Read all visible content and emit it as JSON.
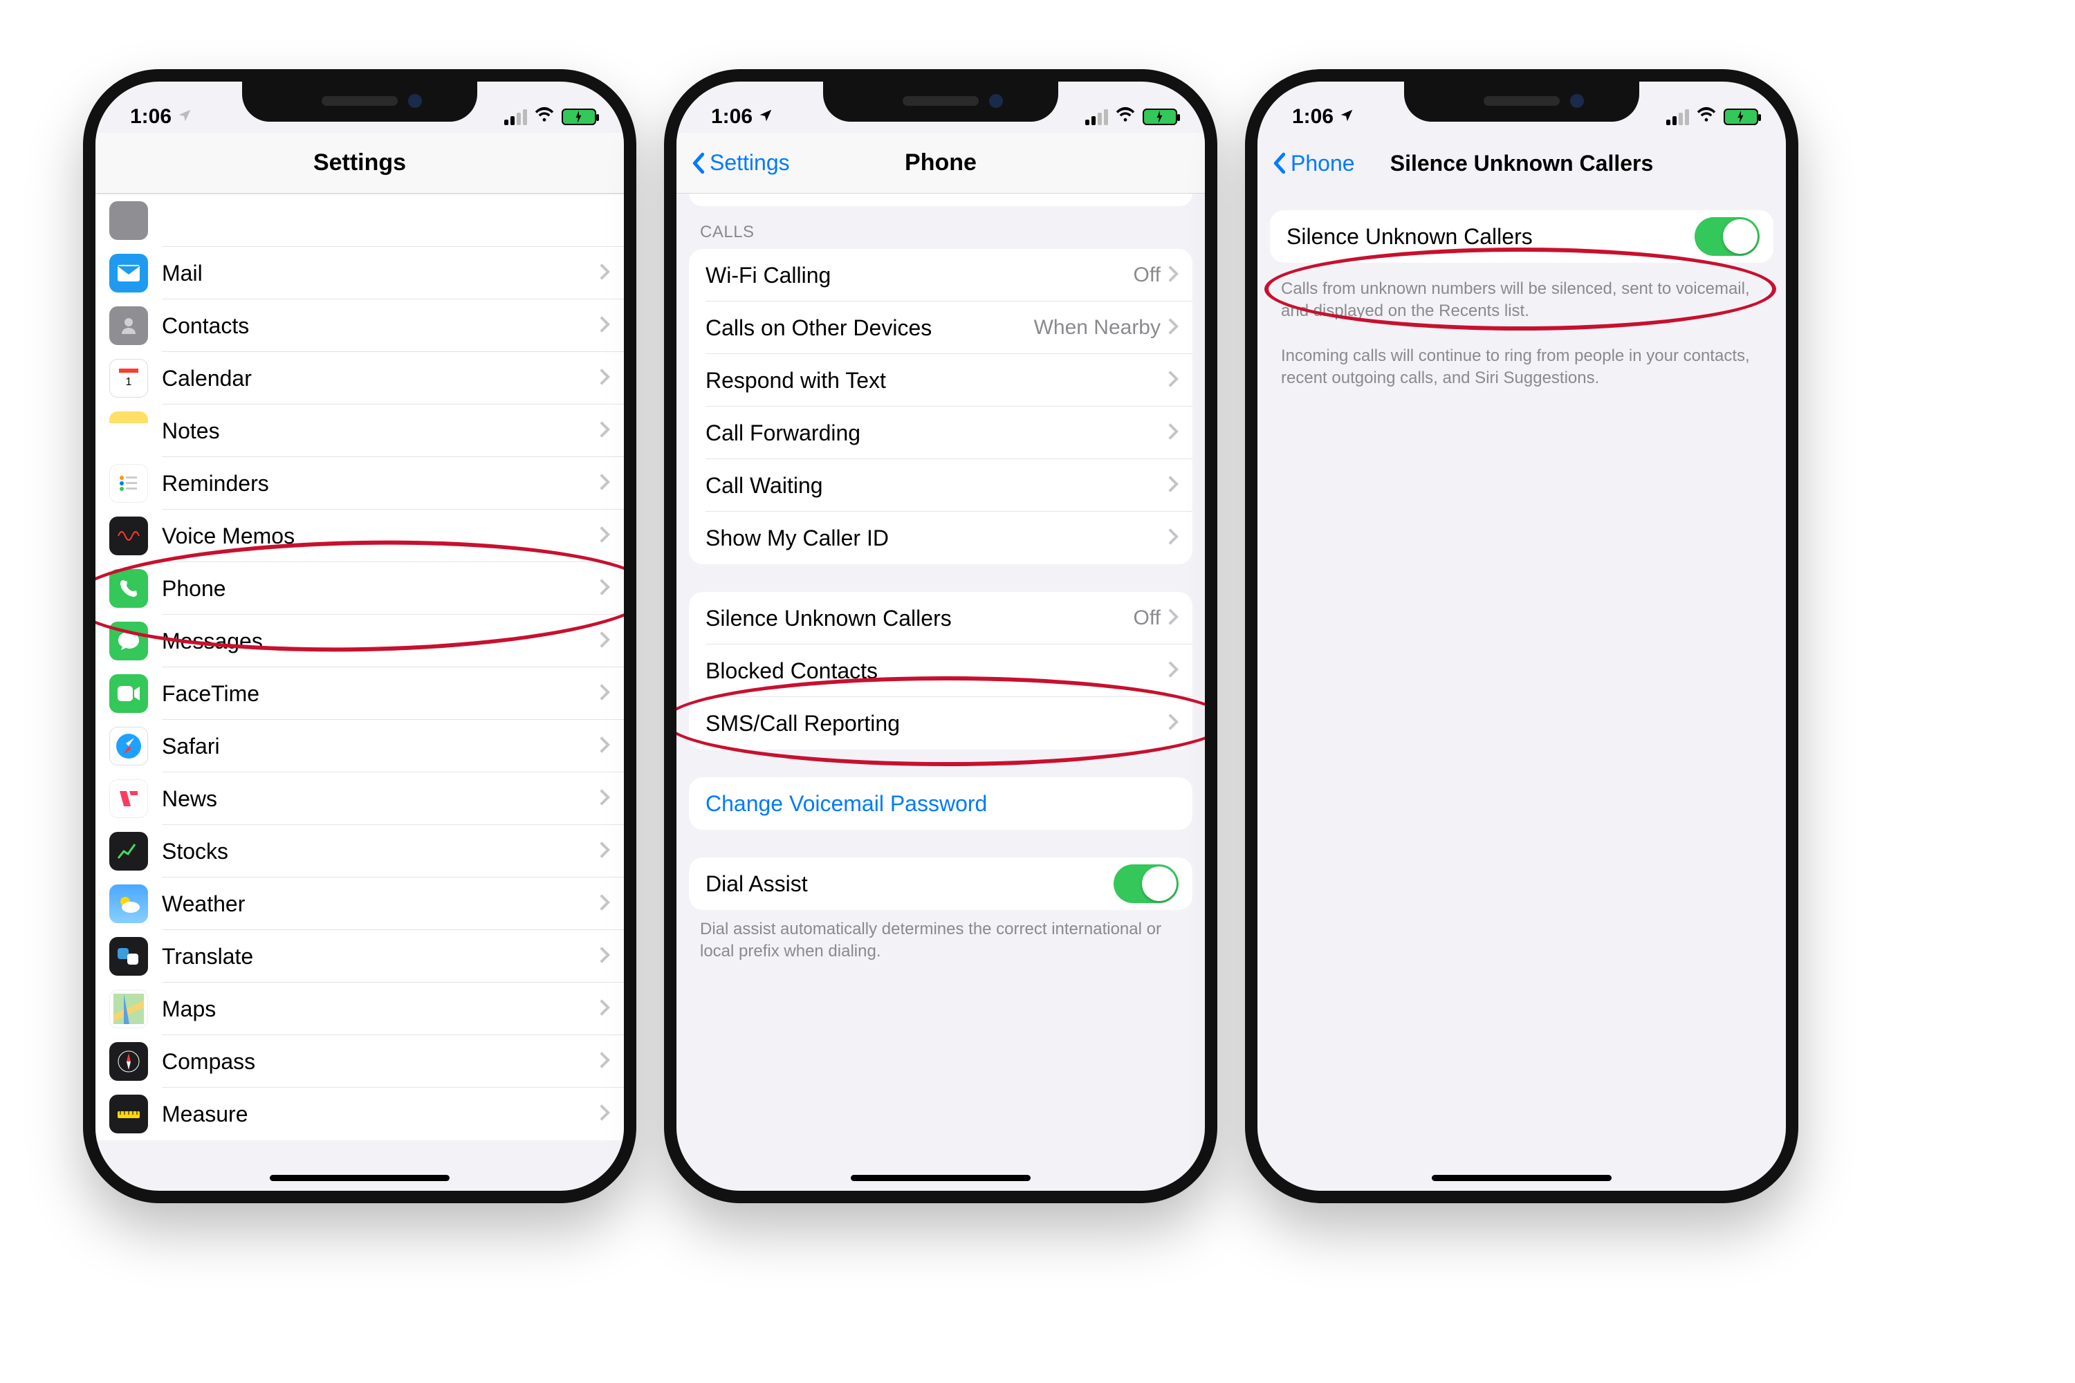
{
  "statusbar": {
    "time": "1:06"
  },
  "phone1": {
    "title": "Settings",
    "items": [
      {
        "label": "Mail"
      },
      {
        "label": "Contacts"
      },
      {
        "label": "Calendar"
      },
      {
        "label": "Notes"
      },
      {
        "label": "Reminders"
      },
      {
        "label": "Voice Memos"
      },
      {
        "label": "Phone"
      },
      {
        "label": "Messages"
      },
      {
        "label": "FaceTime"
      },
      {
        "label": "Safari"
      },
      {
        "label": "News"
      },
      {
        "label": "Stocks"
      },
      {
        "label": "Weather"
      },
      {
        "label": "Translate"
      },
      {
        "label": "Maps"
      },
      {
        "label": "Compass"
      },
      {
        "label": "Measure"
      }
    ]
  },
  "phone2": {
    "back": "Settings",
    "title": "Phone",
    "section_calls": "CALLS",
    "calls": [
      {
        "label": "Wi-Fi Calling",
        "value": "Off"
      },
      {
        "label": "Calls on Other Devices",
        "value": "When Nearby"
      },
      {
        "label": "Respond with Text",
        "value": ""
      },
      {
        "label": "Call Forwarding",
        "value": ""
      },
      {
        "label": "Call Waiting",
        "value": ""
      },
      {
        "label": "Show My Caller ID",
        "value": ""
      }
    ],
    "group2": [
      {
        "label": "Silence Unknown Callers",
        "value": "Off"
      },
      {
        "label": "Blocked Contacts",
        "value": ""
      },
      {
        "label": "SMS/Call Reporting",
        "value": ""
      }
    ],
    "voicemail_link": "Change Voicemail Password",
    "dial_assist": "Dial Assist",
    "dial_assist_footer": "Dial assist automatically determines the correct international or local prefix when dialing."
  },
  "phone3": {
    "back": "Phone",
    "title": "Silence Unknown Callers",
    "toggle_label": "Silence Unknown Callers",
    "footer1": "Calls from unknown numbers will be silenced, sent to voicemail, and displayed on the Recents list.",
    "footer2": "Incoming calls will continue to ring from people in your contacts, recent outgoing calls, and Siri Suggestions."
  }
}
